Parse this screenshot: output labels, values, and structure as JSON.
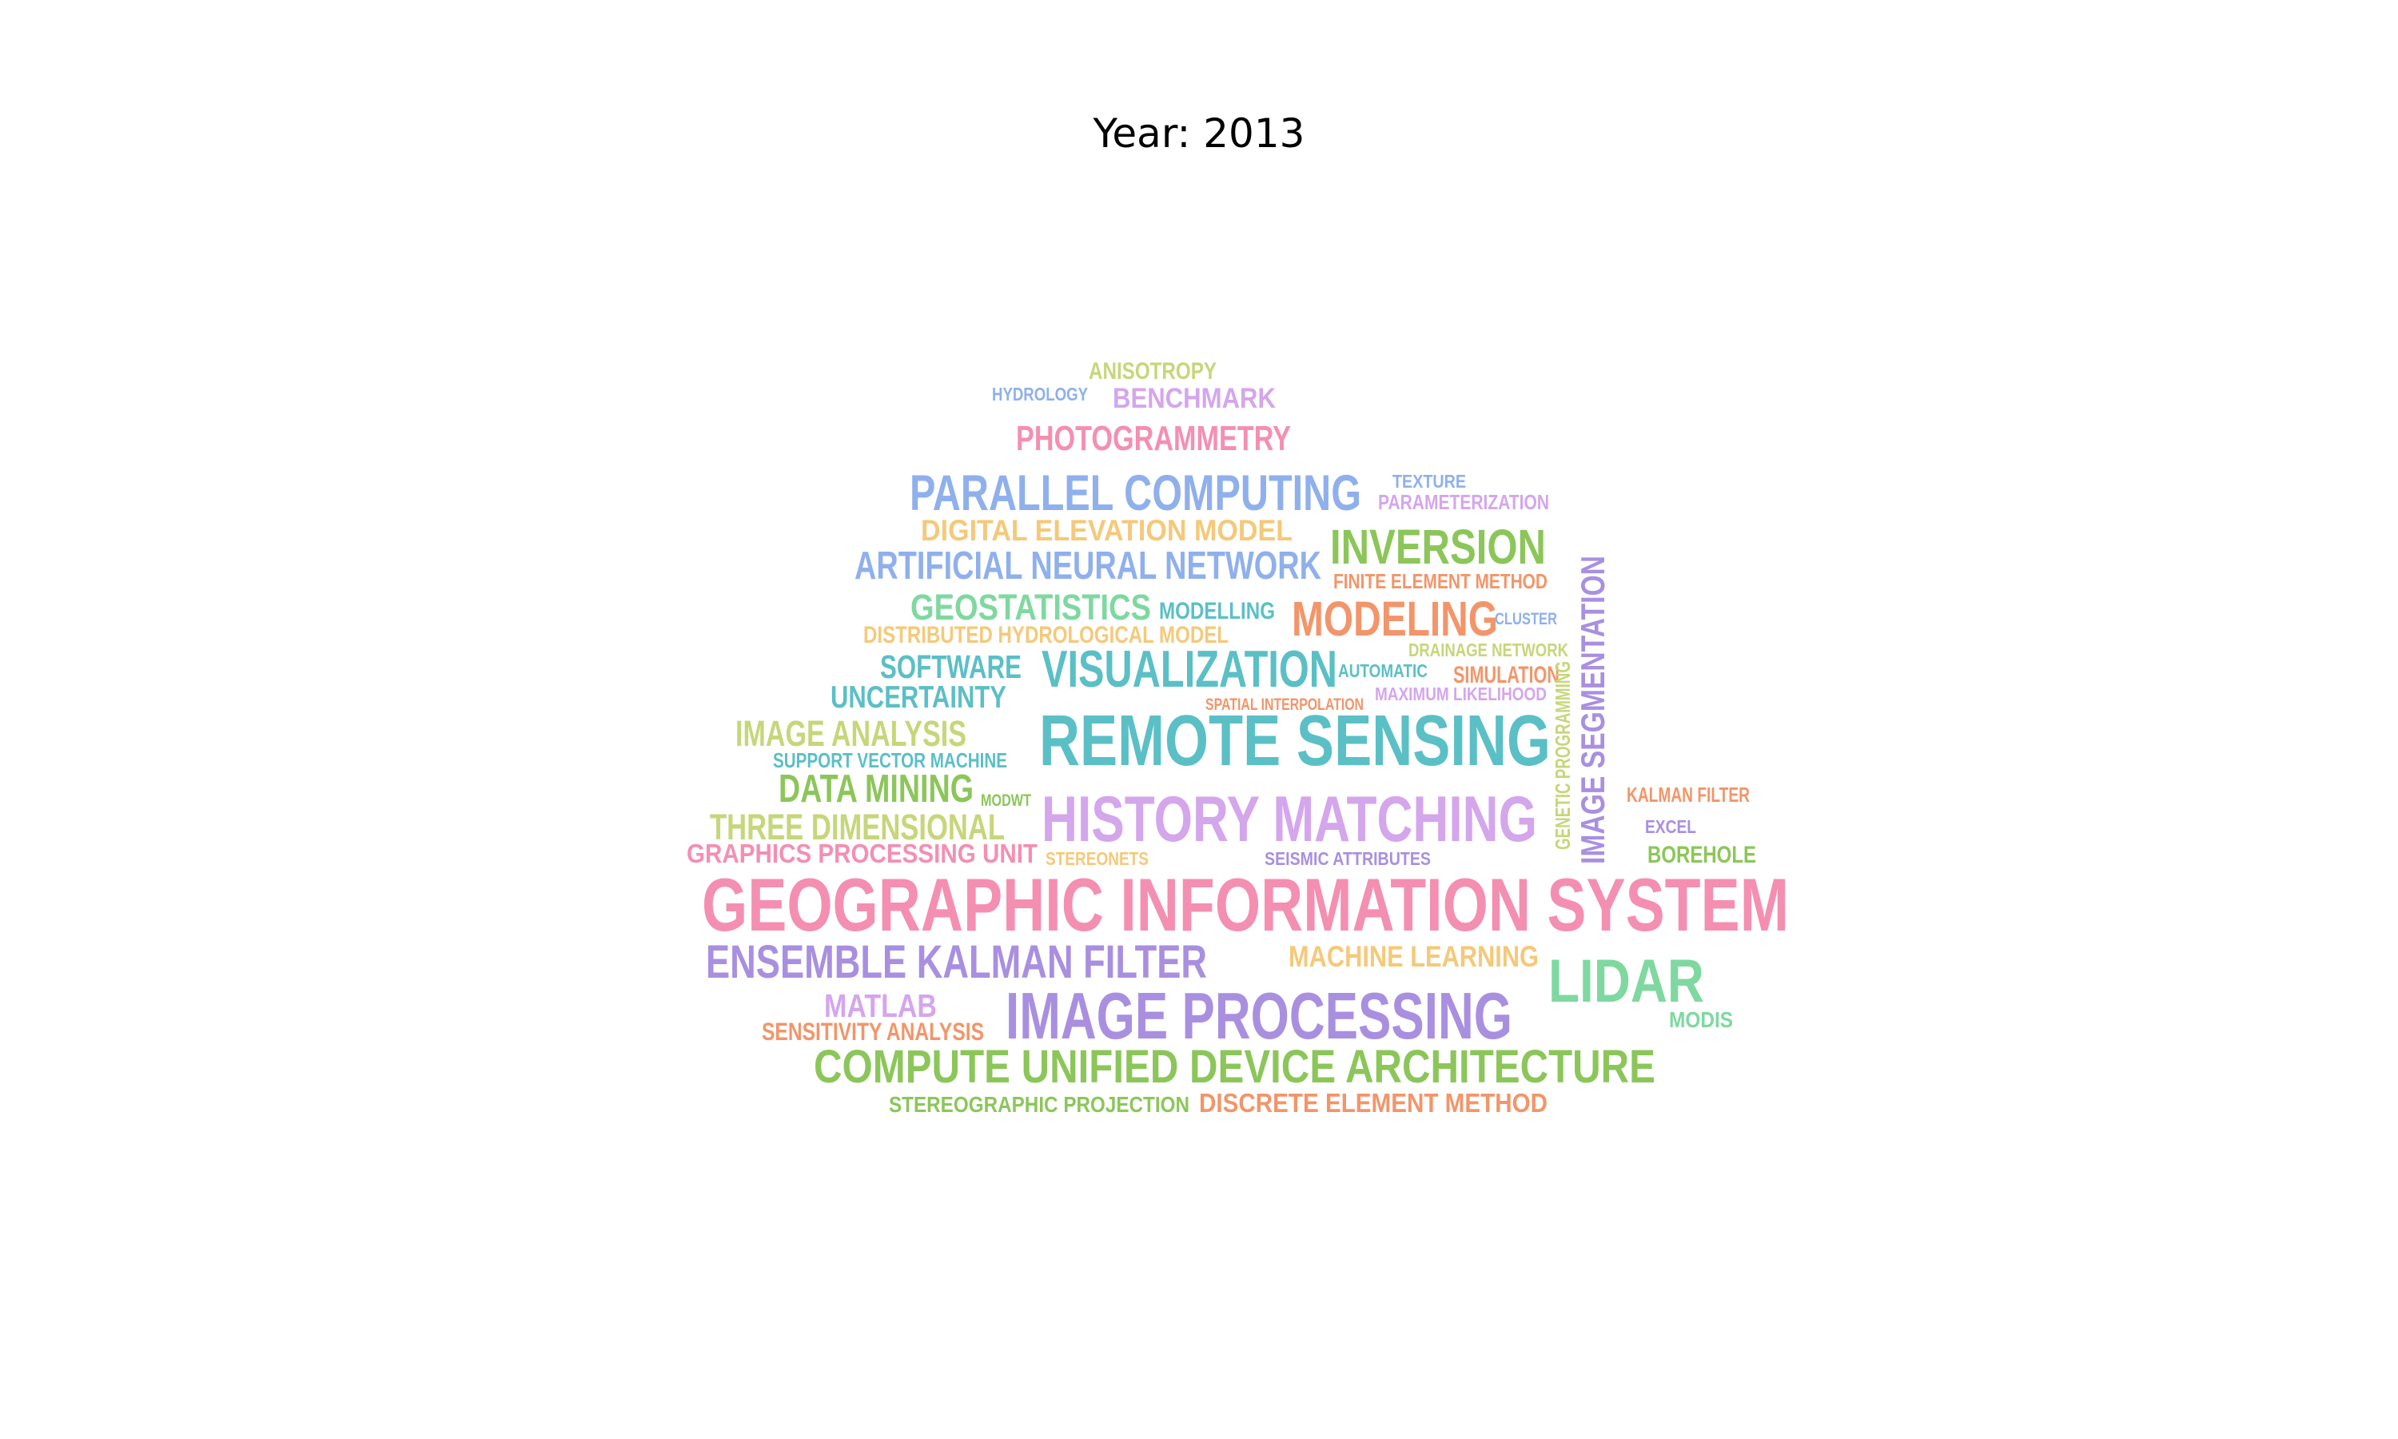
{
  "title": "Year: 2013",
  "words": [
    {
      "text": "GEOGRAPHIC INFORMATION SYSTEM",
      "color": "#f48fb1"
    },
    {
      "text": "REMOTE SENSING",
      "color": "#5bbfc6"
    },
    {
      "text": "HISTORY MATCHING",
      "color": "#d4a6ec"
    },
    {
      "text": "IMAGE PROCESSING",
      "color": "#a98fe0"
    },
    {
      "text": "COMPUTE UNIFIED DEVICE ARCHITECTURE",
      "color": "#8cc65a"
    },
    {
      "text": "LIDAR",
      "color": "#7fd8a0"
    },
    {
      "text": "ENSEMBLE KALMAN FILTER",
      "color": "#a98fe0"
    },
    {
      "text": "PARALLEL COMPUTING",
      "color": "#8fb0ec"
    },
    {
      "text": "VISUALIZATION",
      "color": "#5bbfc6"
    },
    {
      "text": "INVERSION",
      "color": "#8cc65a"
    },
    {
      "text": "MODELING",
      "color": "#f2956a"
    },
    {
      "text": "ARTIFICIAL NEURAL NETWORK",
      "color": "#8fb0ec"
    },
    {
      "text": "DIGITAL ELEVATION MODEL",
      "color": "#f4c97a"
    },
    {
      "text": "GEOSTATISTICS",
      "color": "#7fd8a0"
    },
    {
      "text": "PHOTOGRAMMETRY",
      "color": "#f48fb1"
    },
    {
      "text": "IMAGE ANALYSIS",
      "color": "#c6d67a"
    },
    {
      "text": "DATA MINING",
      "color": "#8cc65a"
    },
    {
      "text": "THREE DIMENSIONAL",
      "color": "#c6d67a"
    },
    {
      "text": "GRAPHICS PROCESSING UNIT",
      "color": "#f48fb1"
    },
    {
      "text": "MACHINE LEARNING",
      "color": "#f4c97a"
    },
    {
      "text": "SOFTWARE",
      "color": "#5bbfc6"
    },
    {
      "text": "UNCERTAINTY",
      "color": "#5bbfc6"
    },
    {
      "text": "MATLAB",
      "color": "#d4a6ec"
    },
    {
      "text": "BENCHMARK",
      "color": "#d4a6ec"
    },
    {
      "text": "IMAGE SEGMENTATION",
      "color": "#a98fe0"
    },
    {
      "text": "DISCRETE ELEMENT METHOD",
      "color": "#f2956a"
    },
    {
      "text": "STEREOGRAPHIC PROJECTION",
      "color": "#8cc65a"
    },
    {
      "text": "SENSITIVITY ANALYSIS",
      "color": "#f2956a"
    },
    {
      "text": "DISTRIBUTED HYDROLOGICAL MODEL",
      "color": "#f4c97a"
    },
    {
      "text": "MODELLING",
      "color": "#5bbfc6"
    },
    {
      "text": "FINITE ELEMENT METHOD",
      "color": "#f2956a"
    },
    {
      "text": "SUPPORT VECTOR MACHINE",
      "color": "#5bbfc6"
    },
    {
      "text": "ANISOTROPY",
      "color": "#c6d67a"
    },
    {
      "text": "BOREHOLE",
      "color": "#8cc65a"
    },
    {
      "text": "SIMULATION",
      "color": "#f2956a"
    },
    {
      "text": "KALMAN FILTER",
      "color": "#f2956a"
    },
    {
      "text": "PARAMETERIZATION",
      "color": "#d4a6ec"
    },
    {
      "text": "AUTOMATIC",
      "color": "#5bbfc6"
    },
    {
      "text": "DRAINAGE NETWORK",
      "color": "#c6d67a"
    },
    {
      "text": "MAXIMUM LIKELIHOOD",
      "color": "#d4a6ec"
    },
    {
      "text": "SEISMIC ATTRIBUTES",
      "color": "#a98fe0"
    },
    {
      "text": "SPATIAL INTERPOLATION",
      "color": "#f2956a"
    },
    {
      "text": "GENETIC PROGRAMMING",
      "color": "#c6d67a"
    },
    {
      "text": "MODIS",
      "color": "#7fd8a0"
    },
    {
      "text": "STEREONETS",
      "color": "#f4c97a"
    },
    {
      "text": "TEXTURE",
      "color": "#8fb0ec"
    },
    {
      "text": "CLUSTER",
      "color": "#8fb0ec"
    },
    {
      "text": "HYDROLOGY",
      "color": "#8fb0ec"
    },
    {
      "text": "EXCEL",
      "color": "#a98fe0"
    },
    {
      "text": "MODWT",
      "color": "#8cc65a"
    }
  ]
}
